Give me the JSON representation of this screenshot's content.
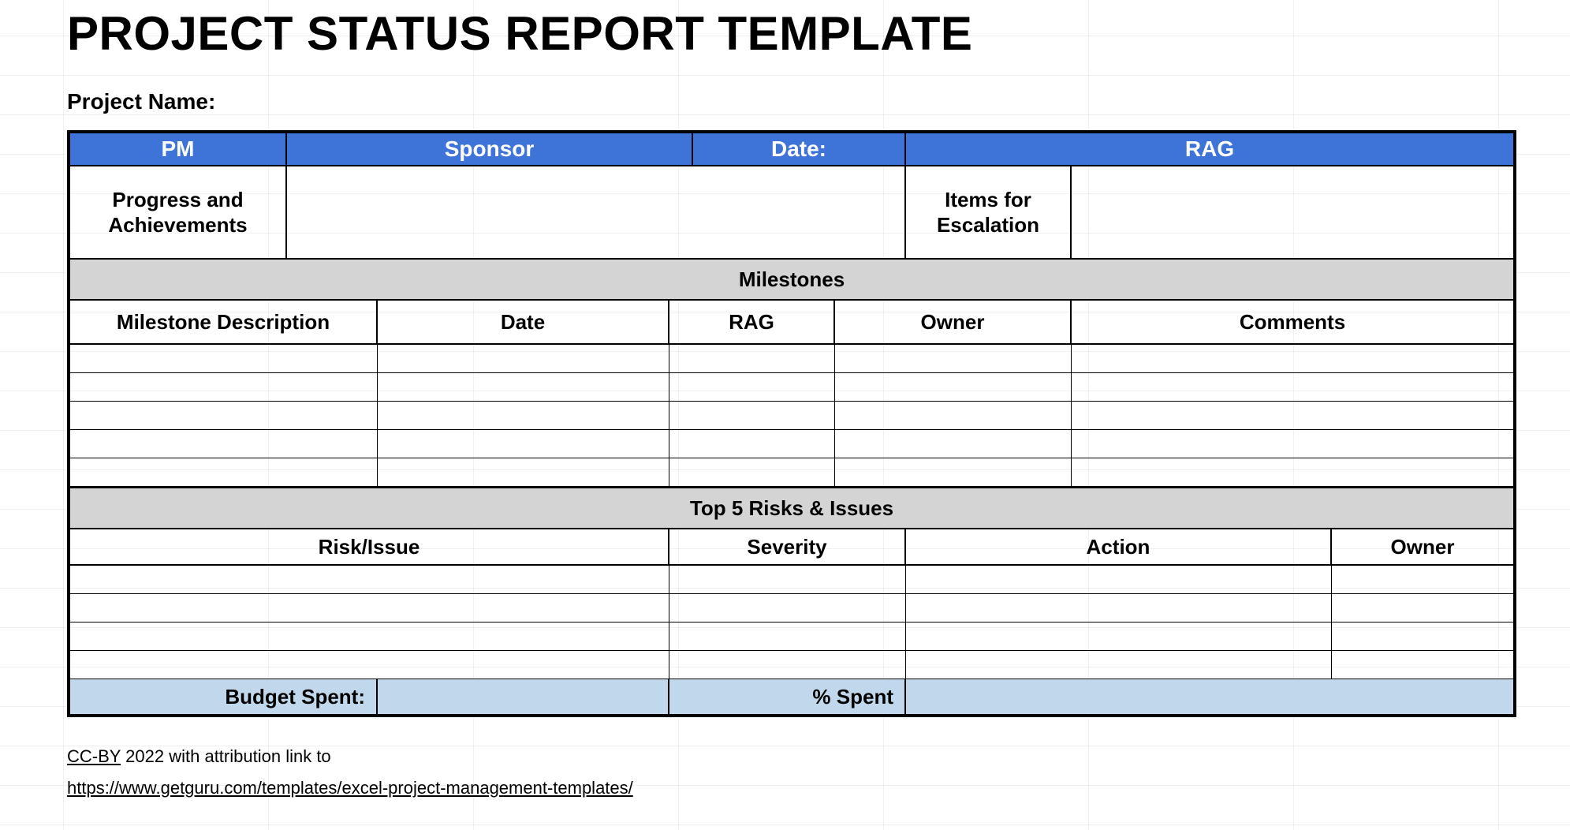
{
  "title": "PROJECT STATUS REPORT TEMPLATE",
  "project_name_label": "Project  Name:",
  "summary_header": {
    "pm": "PM",
    "sponsor": "Sponsor",
    "date": "Date:",
    "rag": "RAG"
  },
  "progress_row": {
    "progress_label": "Progress and Achievements",
    "progress_value": "",
    "escalation_label": "Items for Escalation",
    "escalation_value": ""
  },
  "milestones": {
    "banner": "Milestones",
    "columns": {
      "description": "Milestone Description",
      "date": "Date",
      "rag": "RAG",
      "owner": "Owner",
      "comments": "Comments"
    },
    "rows": [
      {
        "description": "",
        "date": "",
        "rag": "",
        "owner": "",
        "comments": ""
      },
      {
        "description": "",
        "date": "",
        "rag": "",
        "owner": "",
        "comments": ""
      },
      {
        "description": "",
        "date": "",
        "rag": "",
        "owner": "",
        "comments": ""
      },
      {
        "description": "",
        "date": "",
        "rag": "",
        "owner": "",
        "comments": ""
      },
      {
        "description": "",
        "date": "",
        "rag": "",
        "owner": "",
        "comments": ""
      }
    ]
  },
  "risks": {
    "banner": "Top 5 Risks & Issues",
    "columns": {
      "risk_issue": "Risk/Issue",
      "severity": "Severity",
      "action": "Action",
      "owner": "Owner"
    },
    "rows": [
      {
        "risk_issue": "",
        "severity": "",
        "action": "",
        "owner": ""
      },
      {
        "risk_issue": "",
        "severity": "",
        "action": "",
        "owner": ""
      },
      {
        "risk_issue": "",
        "severity": "",
        "action": "",
        "owner": ""
      },
      {
        "risk_issue": "",
        "severity": "",
        "action": "",
        "owner": ""
      }
    ]
  },
  "budget": {
    "spent_label": "Budget Spent:",
    "spent_value": "",
    "pct_label": "% Spent",
    "pct_value": ""
  },
  "attribution": {
    "line1_link": "CC-BY",
    "line1_rest": " 2022 with attribution link to",
    "line2_url": "https://www.getguru.com/templates/excel-project-management-templates/"
  }
}
